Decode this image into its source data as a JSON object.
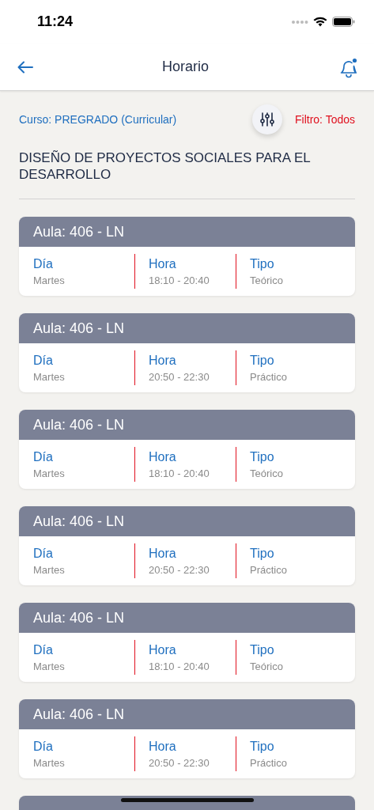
{
  "status_bar": {
    "time": "11:24"
  },
  "nav": {
    "title": "Horario",
    "has_notification": true
  },
  "filter": {
    "course": "Curso: PREGRADO (Curricular)",
    "filter": "Filtro: Todos"
  },
  "subject": "DISEÑO DE PROYECTOS SOCIALES PARA EL DESARROLLO",
  "sessions": [
    {
      "room": "Aula: 406 - LN",
      "day_label": "Día",
      "day": "Martes",
      "time_label": "Hora",
      "time": "18:10 - 20:40",
      "type_label": "Tipo",
      "type": "Teórico"
    },
    {
      "room": "Aula: 406 - LN",
      "day_label": "Día",
      "day": "Martes",
      "time_label": "Hora",
      "time": "20:50 - 22:30",
      "type_label": "Tipo",
      "type": "Práctico"
    },
    {
      "room": "Aula: 406 - LN",
      "day_label": "Día",
      "day": "Martes",
      "time_label": "Hora",
      "time": "18:10 - 20:40",
      "type_label": "Tipo",
      "type": "Teórico"
    },
    {
      "room": "Aula: 406 - LN",
      "day_label": "Día",
      "day": "Martes",
      "time_label": "Hora",
      "time": "20:50 - 22:30",
      "type_label": "Tipo",
      "type": "Práctico"
    },
    {
      "room": "Aula: 406 - LN",
      "day_label": "Día",
      "day": "Martes",
      "time_label": "Hora",
      "time": "18:10 - 20:40",
      "type_label": "Tipo",
      "type": "Teórico"
    },
    {
      "room": "Aula: 406 - LN",
      "day_label": "Día",
      "day": "Martes",
      "time_label": "Hora",
      "time": "20:50 - 22:30",
      "type_label": "Tipo",
      "type": "Práctico"
    }
  ]
}
